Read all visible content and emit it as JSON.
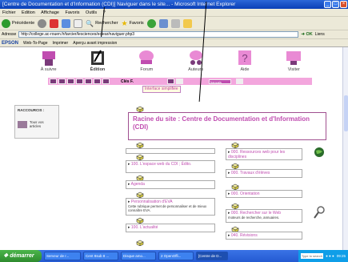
{
  "window": {
    "title": "[Centre de Documentation et d'Information (CDI)] Naviguer dans le site... - Microsoft Internet Explorer"
  },
  "menu": [
    "Fichier",
    "Edition",
    "Affichage",
    "Favoris",
    "Outils",
    "?"
  ],
  "toolbar": {
    "back": "Précédente",
    "search": "Rechercher",
    "favorites": "Favoris"
  },
  "address": {
    "label": "Adresse",
    "url": "http://college.ac-rouen.fr/tarcier/lesciences/eclear/naviguer.php3",
    "go": "OK",
    "links": "Liens"
  },
  "epson": {
    "logo": "EPSON",
    "web_to_page": "Web-To-Page",
    "print": "Imprimer",
    "preview": "Aperçu avant impression"
  },
  "nav": [
    {
      "label": "À suivre",
      "active": false
    },
    {
      "label": "Édition",
      "active": true
    },
    {
      "label": "Forum",
      "active": false
    },
    {
      "label": "Auteurs",
      "active": false
    },
    {
      "label": "Aide",
      "active": false
    },
    {
      "label": "Visiter",
      "active": false
    }
  ],
  "pinkbar": {
    "cle": "Clés F.",
    "lang": "français"
  },
  "tooltip": "Interface simplifiée",
  "login": {
    "title": "RACCOURCIS :",
    "link": "Tous vos articles"
  },
  "rootbox": {
    "title": "Racine du site : Centre de Documentation et d'Information (CDI)"
  },
  "sections": [
    {
      "title": "",
      "desc": ""
    },
    {
      "title": "000. Ressources web pour les disciplines",
      "desc": ""
    },
    {
      "title": "100. L'espace web du CDI ; Édito.",
      "desc": ""
    },
    {
      "title": "000. Travaux d'élèves",
      "desc": ""
    },
    {
      "title": "Agenda",
      "desc": ""
    },
    {
      "title": "000. Orientation",
      "desc": ""
    },
    {
      "title": "Personnalisation d'EVA",
      "desc": "Cette rubrique permet de personnaliser et de mieux connaître EVA."
    },
    {
      "title": "000. Rechercher sur le Web",
      "desc": "moteurs de recherche, annuaires."
    },
    {
      "title": "100. L'actualité",
      "desc": ""
    },
    {
      "title": "040. Révisions",
      "desc": ""
    }
  ],
  "taskbar": {
    "start": "démarrer",
    "tasks": [
      "Serveur de r...",
      "Cent 8sub 8 ...",
      "Disque amo...",
      "2 OpenOffi...",
      "[Centre de D...",
      "Type to search"
    ],
    "clock": "09:25"
  }
}
